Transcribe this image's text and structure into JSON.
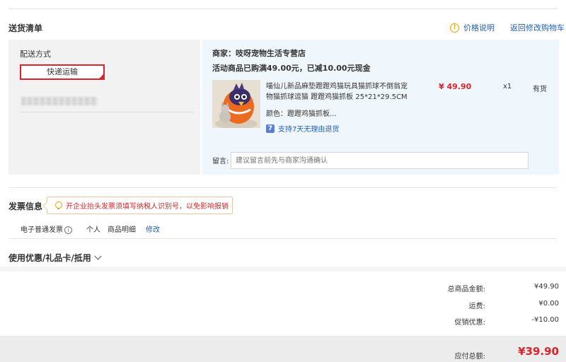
{
  "header": {
    "title": "送货清单",
    "price_note": "价格说明",
    "back_link": "返回修改购物车"
  },
  "shipping": {
    "label": "配送方式",
    "option": "快递运输"
  },
  "store": {
    "merchant": "商家：吱呀宠物生活专营店",
    "promo": "活动商品已购满49.00元，已减10.00元现金",
    "product": {
      "title": "喵仙儿新品麻垫蹬蹬鸡猫玩具猫抓球不倒翁宠物猫抓球逗猫 蹬蹬鸡猫抓板 25*21*29.5CM",
      "price": "¥ 49.90",
      "qty": "x1",
      "stock": "有货",
      "color": "颜色：蹬蹬鸡猫抓板...",
      "returns": "支持7天无理由退货",
      "returns_badge": "7"
    },
    "message": {
      "label": "留言:",
      "placeholder": "建议留言前先与商家沟通确认"
    }
  },
  "invoice": {
    "title": "发票信息",
    "tip": "开企业抬头发票须填写纳税人识别号，以免影响报销",
    "type": "电子普通发票",
    "title_type": "个人",
    "content": "商品明细",
    "edit": "修改"
  },
  "coupon": {
    "title": "使用优惠/礼品卡/抵用"
  },
  "totals": {
    "rows": [
      {
        "label": "总商品金额:",
        "value": "¥49.90"
      },
      {
        "label": "运费:",
        "value": "¥0.00"
      },
      {
        "label": "促销优惠:",
        "value": "-¥10.00"
      }
    ],
    "payable_label": "应付总额:",
    "payable_value": "¥39.90"
  }
}
